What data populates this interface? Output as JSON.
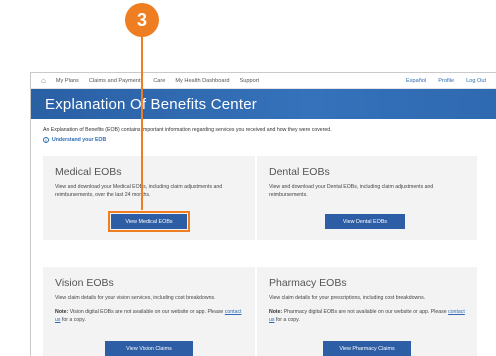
{
  "callout": {
    "number": "3"
  },
  "topnav": {
    "items": [
      "My Plans",
      "Claims and Payments",
      "Care",
      "My Health Dashboard",
      "Support"
    ],
    "utilities": [
      "Español",
      "Profile",
      "Log Out"
    ]
  },
  "banner": {
    "title": "Explanation Of Benefits Center"
  },
  "intro": {
    "description": "An Explanation of Benefits (EOB) contains important information regarding services you received and how they were covered.",
    "understand_link": "Understand your EOB"
  },
  "cards": {
    "medical": {
      "title": "Medical EOBs",
      "description": "View and download your Medical EOBs, including claim adjustments and reimbursements, over the last 24 months.",
      "button": "View Medical EOBs"
    },
    "dental": {
      "title": "Dental EOBs",
      "description": "View and download your Dental EOBs, including claim adjustments and reimbursements.",
      "button": "View Dental EOBs"
    },
    "vision": {
      "title": "Vision EOBs",
      "description": "View claim details for your vision services, including cost breakdowns.",
      "note_label": "Note:",
      "note_text": " Vision digital EOBs are not available on our website or app. Please ",
      "note_link": "contact us",
      "note_end": " for a copy.",
      "button": "View Vision Claims"
    },
    "pharmacy": {
      "title": "Pharmacy EOBs",
      "description": "View claim details for your prescriptions, including cost breakdowns.",
      "note_label": "Note:",
      "note_text": " Pharmacy digital EOBs are not available on our website or app. Please ",
      "note_link": "contact us",
      "note_end": " for a copy.",
      "button": "View Pharmacy Claims"
    }
  },
  "colors": {
    "accent": "#ef7d21",
    "banner": "#2e69b1",
    "button": "#2d5da4",
    "link": "#2d6cb5"
  }
}
